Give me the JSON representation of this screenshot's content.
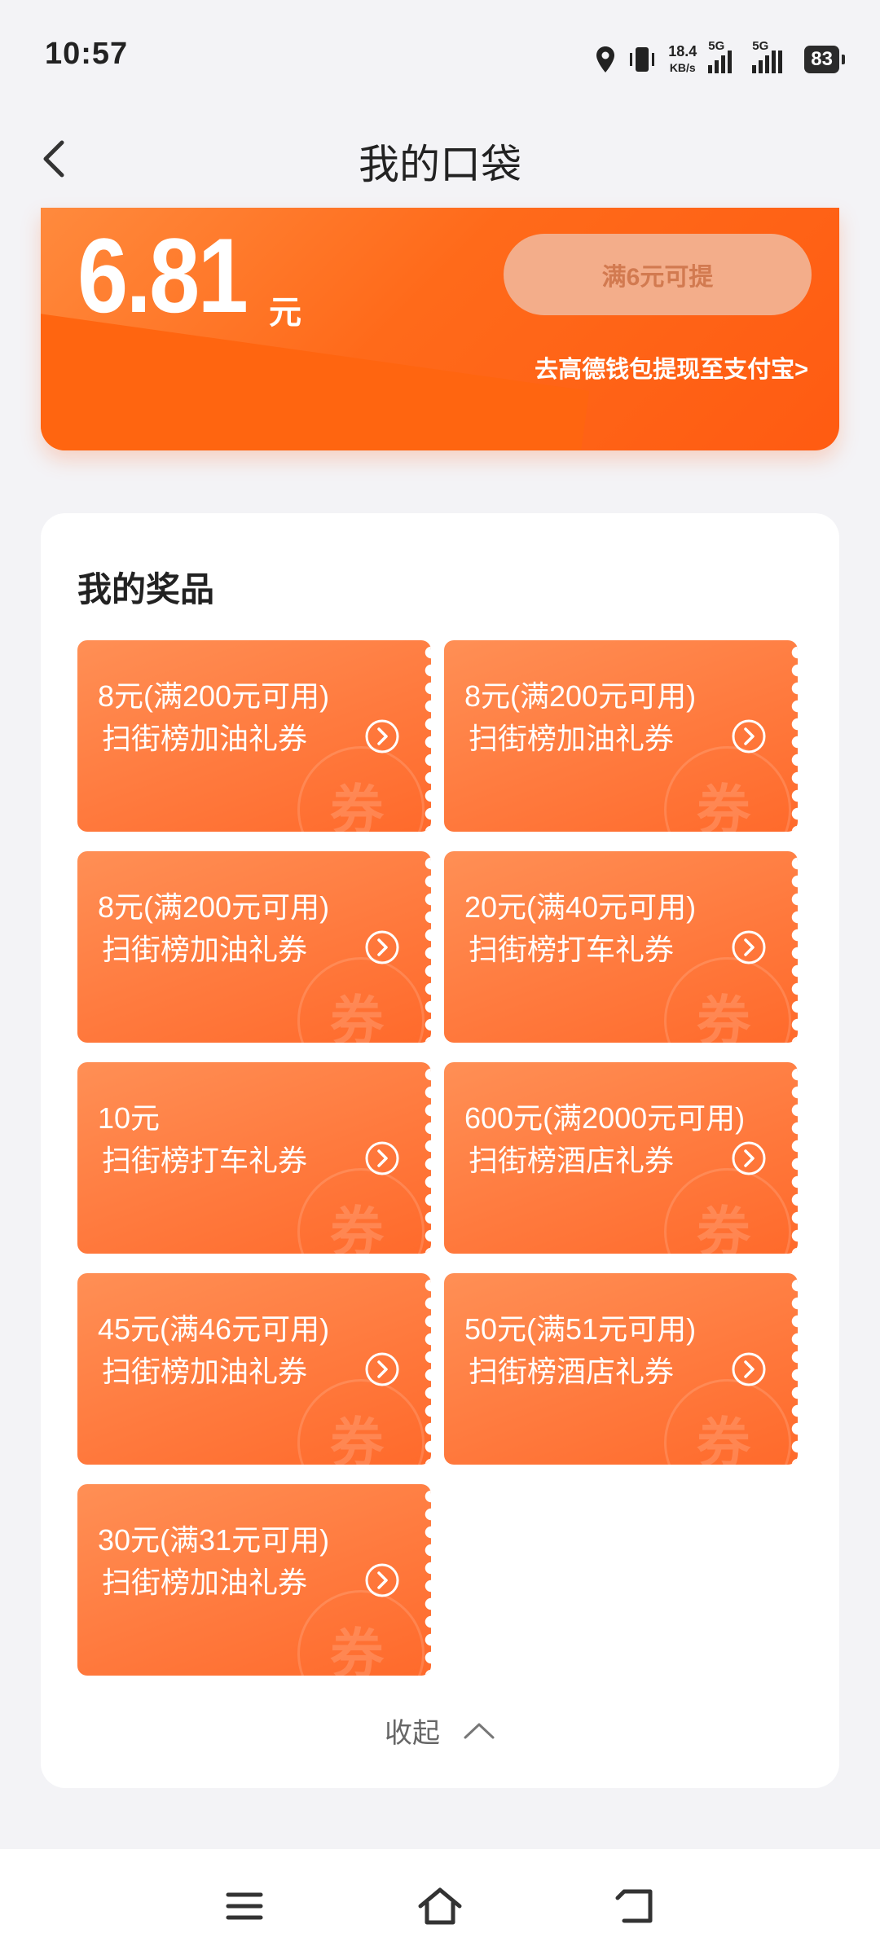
{
  "status": {
    "time": "10:57",
    "speed_value": "18.4",
    "speed_unit": "KB/s",
    "net1": "5G",
    "net2": "5G",
    "battery": "83"
  },
  "header": {
    "title": "我的口袋"
  },
  "wallet": {
    "amount": "6.81",
    "unit": "元",
    "withdraw_label": "满6元可提",
    "link_text": "去高德钱包提现至支付宝>"
  },
  "prizes": {
    "title": "我的奖品",
    "watermark": "券",
    "coupons": [
      {
        "line1": "8元(满200元可用)",
        "line2": "扫街榜加油礼券"
      },
      {
        "line1": "8元(满200元可用)",
        "line2": "扫街榜加油礼券"
      },
      {
        "line1": "8元(满200元可用)",
        "line2": "扫街榜加油礼券"
      },
      {
        "line1": "20元(满40元可用)",
        "line2": "扫街榜打车礼券"
      },
      {
        "line1": "10元",
        "line2": "扫街榜打车礼券"
      },
      {
        "line1": "600元(满2000元可用)",
        "line2": "扫街榜酒店礼券"
      },
      {
        "line1": "45元(满46元可用)",
        "line2": "扫街榜加油礼券"
      },
      {
        "line1": "50元(满51元可用)",
        "line2": "扫街榜酒店礼券"
      },
      {
        "line1": "30元(满31元可用)",
        "line2": "扫街榜加油礼券"
      }
    ],
    "collapse_label": "收起"
  },
  "icons": {
    "back": "chevron-left-icon",
    "arrow": "circle-arrow-right-icon",
    "collapse": "chevron-up-icon",
    "menu": "menu-icon",
    "home": "home-icon",
    "return": "back-icon"
  }
}
